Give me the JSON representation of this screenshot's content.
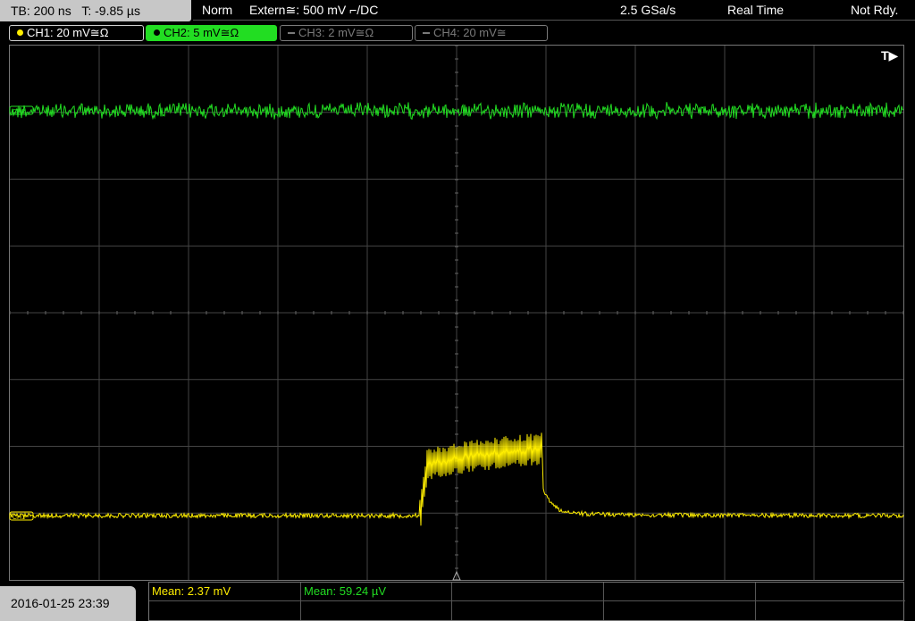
{
  "status": {
    "timebase": "TB: 200 ns",
    "trigger_time": "T: -9.85 µs",
    "trigger_mode": "Norm",
    "trigger_source": "Extern≅: 500 mV ⌐/DC",
    "sample_rate": "2.5 GSa/s",
    "acq_mode": "Real Time",
    "state": "Not Rdy."
  },
  "channels": [
    {
      "label": "CH1: 20 mV≅Ω",
      "color": "#ffee00",
      "active": true
    },
    {
      "label": "CH2: 5 mV≅Ω",
      "color": "#22dd22",
      "active": true,
      "selected": true
    },
    {
      "label": "CH3: 2 mV≅Ω",
      "color": "#7a7a7a",
      "active": false
    },
    {
      "label": "CH4: 20 mV≅",
      "color": "#7a7a7a",
      "active": false
    }
  ],
  "trigger_marker": "T▶",
  "ch1_marker": "CH1",
  "ch2_marker": "CH2",
  "timestamp": "2016-01-25 23:39",
  "measurements": [
    {
      "text": "Mean: 2.37 mV",
      "color": "#ffee00"
    },
    {
      "text": "Mean: 59.24 µV",
      "color": "#22dd22"
    }
  ]
}
